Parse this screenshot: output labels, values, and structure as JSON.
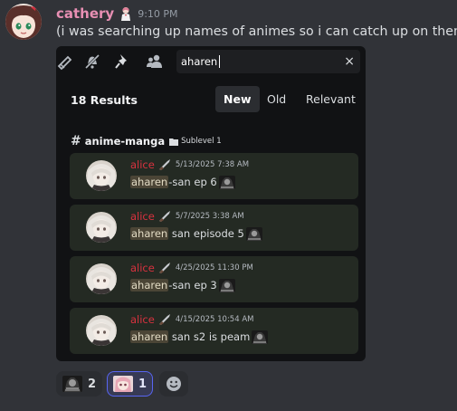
{
  "message": {
    "author": "cathery",
    "timestamp": "9:10 PM",
    "text": "(i was searching up names of animes so i can catch up on them)",
    "author_color": "#e78fb3"
  },
  "search": {
    "query": "aharen",
    "toolbar_icons": [
      "slash-icon",
      "bell-off-icon",
      "pin-icon",
      "members-icon"
    ],
    "clear_icon": "×",
    "results_count": "18 Results",
    "sort_tabs": [
      {
        "label": "New",
        "active": true
      },
      {
        "label": "Old",
        "active": false
      },
      {
        "label": "Relevant",
        "active": false
      }
    ],
    "channel": {
      "hash": "#",
      "name": "anime-manga",
      "folder_icon": "folder-icon",
      "sublevel": "Sublevel 1"
    },
    "results": [
      {
        "author": "alice",
        "date": "5/13/2025 7:38 AM",
        "highlight": "aharen",
        "rest": "-san ep 6"
      },
      {
        "author": "alice",
        "date": "5/7/2025 3:38 AM",
        "highlight": "aharen",
        "rest": " san episode 5"
      },
      {
        "author": "alice",
        "date": "4/25/2025 11:30 PM",
        "highlight": "aharen",
        "rest": "-san ep 3"
      },
      {
        "author": "alice",
        "date": "4/15/2025 10:54 AM",
        "highlight": "aharen",
        "rest": " san s2 is peam"
      }
    ],
    "result_author_color": "#d8323f",
    "highlight_color": "#4b4536"
  },
  "reactions": [
    {
      "emoji": "dark-character-emoji",
      "count": "2",
      "mine": false
    },
    {
      "emoji": "anime-girl-emoji",
      "count": "1",
      "mine": true
    }
  ],
  "add_reaction_icon": "smiley-icon",
  "accent": "#5865f2"
}
